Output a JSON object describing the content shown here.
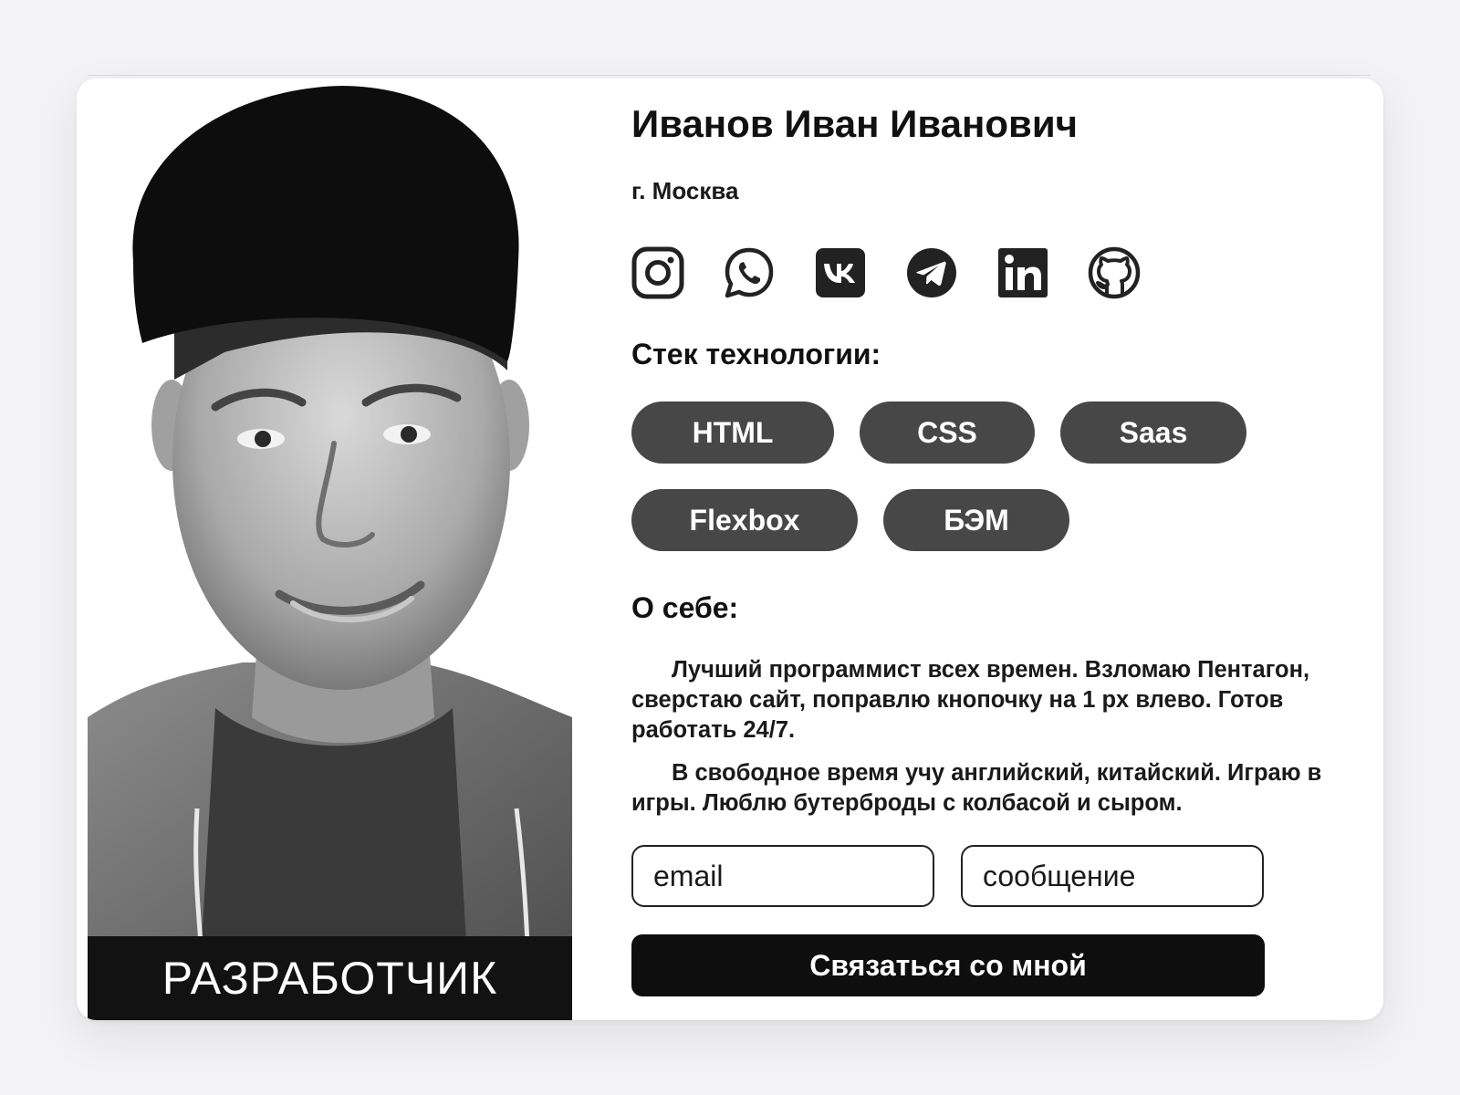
{
  "profile": {
    "name": "Иванов Иван Иванович",
    "city": "г. Москва",
    "role": "РАЗРАБОТЧИК"
  },
  "socials": [
    {
      "icon": "instagram-icon",
      "label": "Instagram"
    },
    {
      "icon": "whatsapp-icon",
      "label": "WhatsApp"
    },
    {
      "icon": "vk-icon",
      "label": "VK"
    },
    {
      "icon": "telegram-icon",
      "label": "Telegram"
    },
    {
      "icon": "linkedin-icon",
      "label": "LinkedIn"
    },
    {
      "icon": "github-icon",
      "label": "GitHub"
    }
  ],
  "stack": {
    "title": "Стек технологии:",
    "tags": [
      "HTML",
      "CSS",
      "Saas",
      "Flexbox",
      "БЭМ"
    ]
  },
  "about": {
    "title": "О себе:",
    "paragraphs": [
      "Лучший программист всех времен. Взломаю Пентагон, сверстаю сайт, поправлю кнопочку на 1 px влево. Готов работать 24/7.",
      "В свободное время учу английский, китайский. Играю в игры. Люблю бутерброды с колбасой и сыром."
    ]
  },
  "form": {
    "email_placeholder": "email",
    "message_placeholder": "сообщение",
    "submit_label": "Связаться со мной"
  },
  "colors": {
    "background": "#f3f3f5",
    "card": "#ffffff",
    "tag": "#474747",
    "banner": "#121212",
    "button": "#0e0e0e"
  }
}
